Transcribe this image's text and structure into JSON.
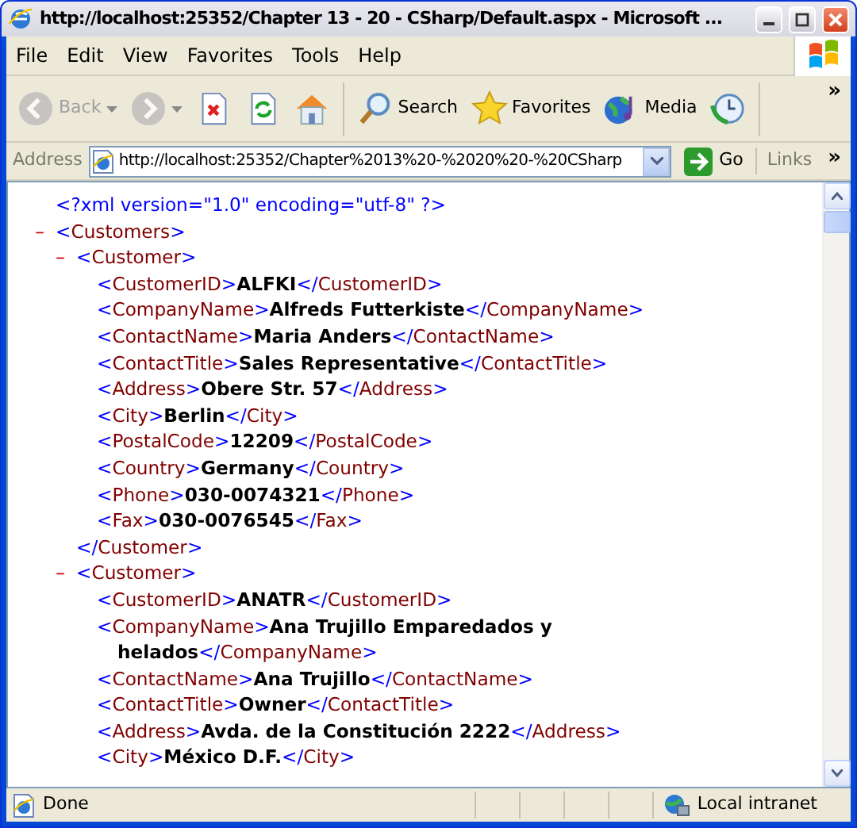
{
  "window": {
    "title": "http://localhost:25352/Chapter 13 - 20 - CSharp/Default.aspx - Microsoft ..."
  },
  "menu": [
    "File",
    "Edit",
    "View",
    "Favorites",
    "Tools",
    "Help"
  ],
  "toolbar": {
    "buttons": [
      {
        "kind": "back",
        "label": "Back",
        "disabled": true,
        "dropdown": true
      },
      {
        "kind": "forward",
        "disabled": true,
        "dropdown": true
      },
      {
        "kind": "stop",
        "disabled": false,
        "dropdown": false
      },
      {
        "kind": "refresh",
        "disabled": false,
        "dropdown": false
      },
      {
        "kind": "home",
        "disabled": false,
        "dropdown": false
      },
      {
        "kind": "search",
        "label": "Search",
        "disabled": false,
        "dropdown": false
      },
      {
        "kind": "favorites",
        "label": "Favorites",
        "disabled": false,
        "dropdown": false
      },
      {
        "kind": "media",
        "label": "Media",
        "disabled": false,
        "dropdown": false
      },
      {
        "kind": "history",
        "disabled": false,
        "dropdown": false
      }
    ],
    "overflow": "»"
  },
  "address_bar": {
    "label": "Address",
    "value": "http://localhost:25352/Chapter%2013%20-%2020%20-%20CSharp",
    "go": "Go",
    "links": "Links",
    "overflow": "»"
  },
  "document": [
    {
      "kind": "pi",
      "text": "<?xml version=\"1.0\" encoding=\"utf-8\" ?>"
    },
    {
      "kind": "element",
      "toggle": "–",
      "open": "<Customers>",
      "children": [
        {
          "kind": "element",
          "toggle": "–",
          "open": "<Customer>",
          "children": [
            {
              "kind": "leaf",
              "open": "<CustomerID>",
              "value": "ALFKI",
              "close": "</CustomerID>"
            },
            {
              "kind": "leaf",
              "open": "<CompanyName>",
              "value": "Alfreds Futterkiste",
              "close": "</CompanyName>"
            },
            {
              "kind": "leaf",
              "open": "<ContactName>",
              "value": "Maria Anders",
              "close": "</ContactName>"
            },
            {
              "kind": "leaf",
              "open": "<ContactTitle>",
              "value": "Sales Representative",
              "close": "</ContactTitle>"
            },
            {
              "kind": "leaf",
              "open": "<Address>",
              "value": "Obere Str. 57",
              "close": "</Address>"
            },
            {
              "kind": "leaf",
              "open": "<City>",
              "value": "Berlin",
              "close": "</City>"
            },
            {
              "kind": "leaf",
              "open": "<PostalCode>",
              "value": "12209",
              "close": "</PostalCode>"
            },
            {
              "kind": "leaf",
              "open": "<Country>",
              "value": "Germany",
              "close": "</Country>"
            },
            {
              "kind": "leaf",
              "open": "<Phone>",
              "value": "030-0074321",
              "close": "</Phone>"
            },
            {
              "kind": "leaf",
              "open": "<Fax>",
              "value": "030-0076545",
              "close": "</Fax>"
            }
          ],
          "close": "</Customer>"
        },
        {
          "kind": "element",
          "toggle": "–",
          "open": "<Customer>",
          "children": [
            {
              "kind": "leaf",
              "open": "<CustomerID>",
              "value": "ANATR",
              "close": "</CustomerID>"
            },
            {
              "kind": "leaf",
              "open": "<CompanyName>",
              "value": "Ana Trujillo Emparedados y helados",
              "close": "</CompanyName>"
            },
            {
              "kind": "leaf",
              "open": "<ContactName>",
              "value": "Ana Trujillo",
              "close": "</ContactName>"
            },
            {
              "kind": "leaf",
              "open": "<ContactTitle>",
              "value": "Owner",
              "close": "</ContactTitle>"
            },
            {
              "kind": "leaf",
              "open": "<Address>",
              "value": "Avda. de la Constitución 2222",
              "close": "</Address>"
            },
            {
              "kind": "leaf",
              "open": "<City>",
              "value": "México D.F.",
              "close": "</City>"
            }
          ]
        }
      ]
    }
  ],
  "status_bar": {
    "text": "Done",
    "zone": "Local intranet"
  }
}
